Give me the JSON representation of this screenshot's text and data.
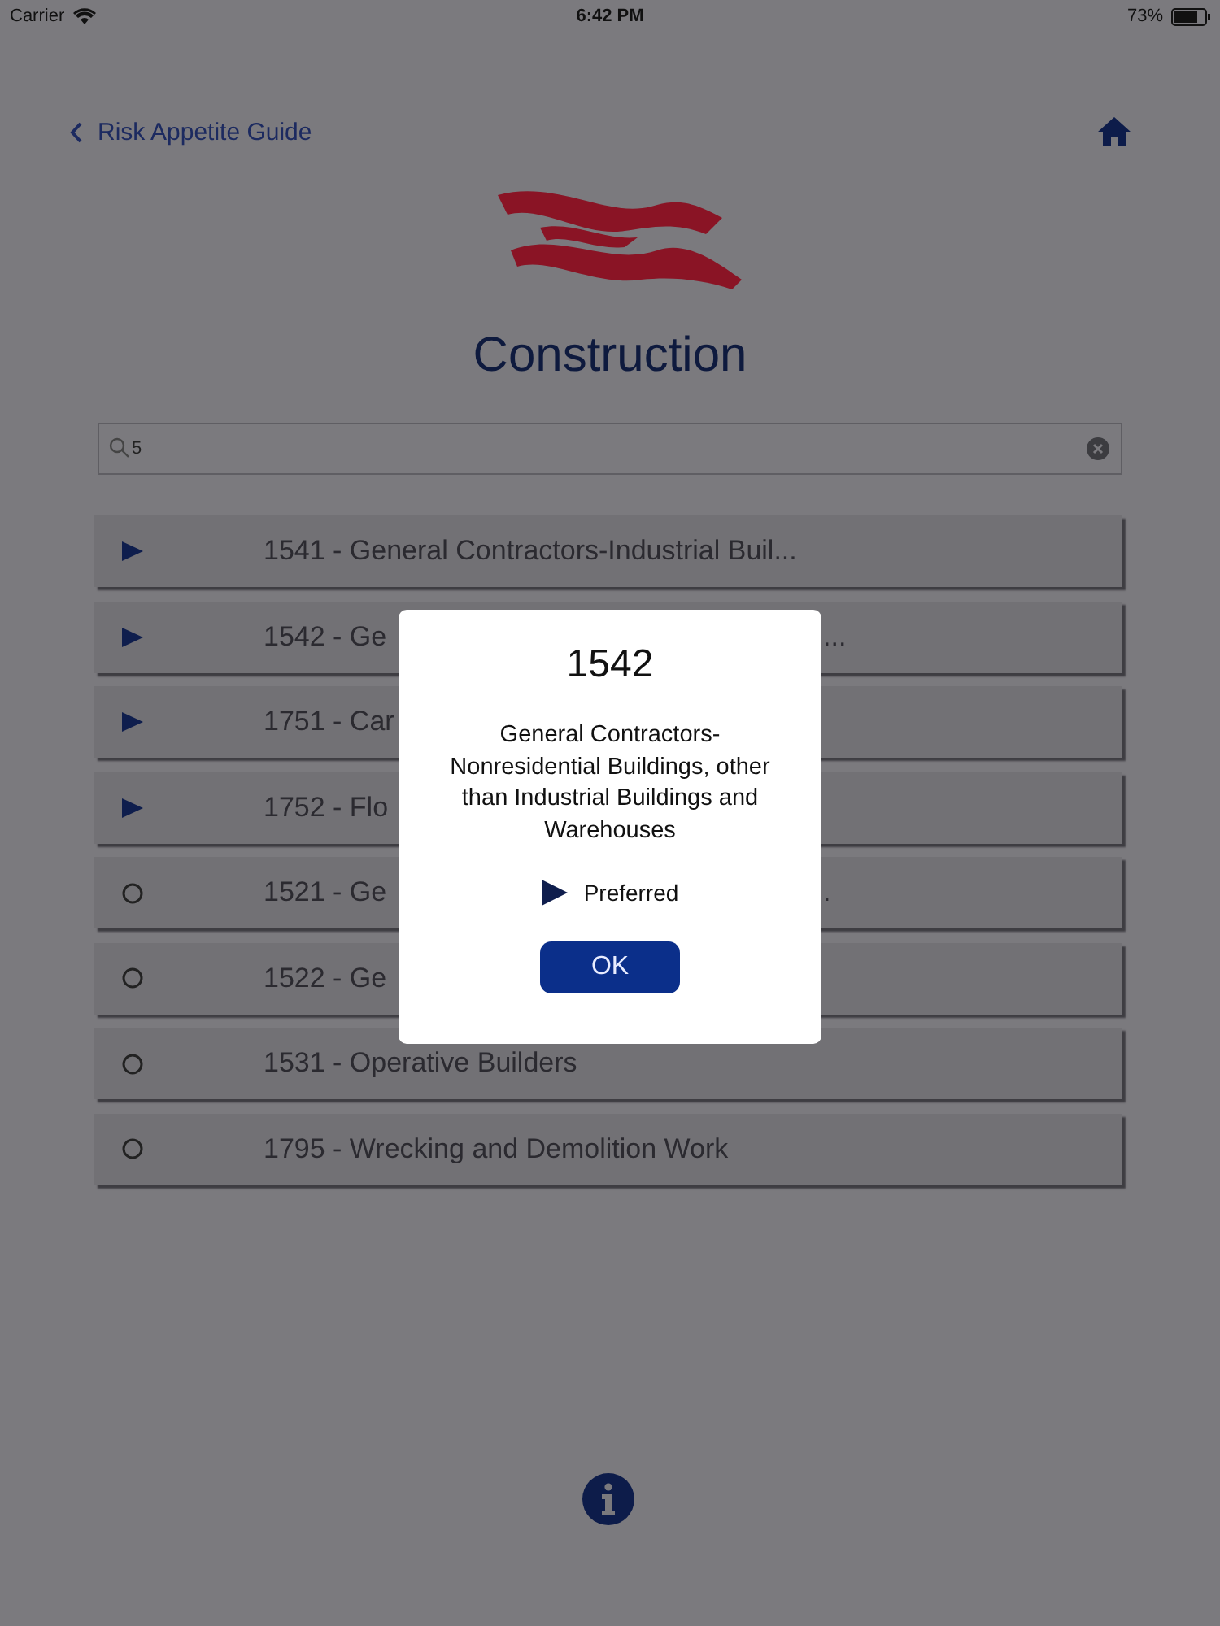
{
  "status_bar": {
    "carrier": "Carrier",
    "time": "6:42 PM",
    "battery": "73%"
  },
  "nav": {
    "back": "Risk Appetite Guide"
  },
  "title": "Construction",
  "search": {
    "value": "5"
  },
  "rows": [
    {
      "kind": "preferred",
      "label": "1541 - General Contractors-Industrial Buil..."
    },
    {
      "kind": "preferred",
      "label": "1542 - Ge",
      "tail": "..."
    },
    {
      "kind": "preferred",
      "label": "1751 - Car"
    },
    {
      "kind": "preferred",
      "label": "1752 - Flo"
    },
    {
      "kind": "other",
      "label": "1521 - Ge",
      "tail": "."
    },
    {
      "kind": "other",
      "label": "1522 - Ge"
    },
    {
      "kind": "other",
      "label": "1531 - Operative Builders"
    },
    {
      "kind": "other",
      "label": "1795 - Wrecking and Demolition Work"
    }
  ],
  "dialog": {
    "title": "1542",
    "message": "General Contractors-Nonresidential Buildings, other than Industrial Buildings and Warehouses",
    "legend": {
      "kind": "preferred",
      "label": "Preferred"
    },
    "button": "OK"
  }
}
